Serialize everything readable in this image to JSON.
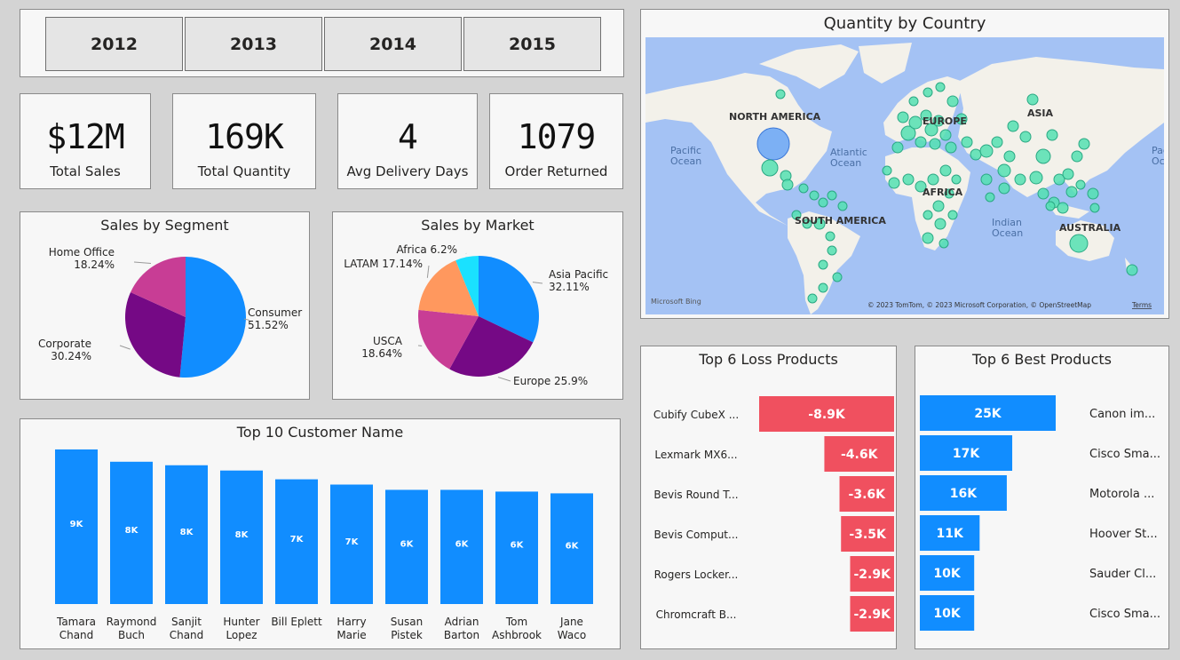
{
  "slicer": {
    "years": [
      "2012",
      "2013",
      "2014",
      "2015"
    ]
  },
  "kpis": [
    {
      "value": "$12M",
      "label": "Total Sales"
    },
    {
      "value": "169K",
      "label": "Total Quantity"
    },
    {
      "value": "4",
      "label": "Avg Delivery Days"
    },
    {
      "value": "1079",
      "label": "Order Returned"
    }
  ],
  "map": {
    "title": "Quantity by Country",
    "labels": {
      "north_america": "NORTH AMERICA",
      "south_america": "SOUTH AMERICA",
      "europe": "EUROPE",
      "africa": "AFRICA",
      "asia": "ASIA",
      "australia": "AUSTRALIA",
      "pacific_left": "Pacific Ocean",
      "pacific_right": "Paci Oce",
      "atlantic": "Atlantic Ocean",
      "indian": "Indian Ocean"
    },
    "bing": "Microsoft Bing",
    "copyright": "© 2023 TomTom, © 2023 Microsoft Corporation, © OpenStreetMap",
    "terms": "Terms"
  },
  "colors": {
    "blue": "#118dff",
    "purple": "#750985",
    "magenta": "#c83d95",
    "orange": "#ff985e",
    "cyan": "#1ae1ff",
    "loss": "#f0505f",
    "ocean": "#a4c2f4",
    "land": "#f3f1ea",
    "bubble": "#54e0b2"
  },
  "chart_data": [
    {
      "type": "pie",
      "title": "Sales by Segment",
      "labels": [
        "Consumer",
        "Corporate",
        "Home Office"
      ],
      "values": [
        51.52,
        30.24,
        18.24
      ],
      "display": [
        "Consumer\n51.52%",
        "Corporate\n30.24%",
        "Home Office\n18.24%"
      ]
    },
    {
      "type": "pie",
      "title": "Sales by Market",
      "labels": [
        "Asia Pacific",
        "Europe",
        "USCA",
        "LATAM",
        "Africa"
      ],
      "values": [
        32.11,
        25.9,
        18.64,
        17.14,
        6.2
      ],
      "display": [
        "Asia Pacific\n32.11%",
        "Europe 25.9%",
        "USCA\n18.64%",
        "LATAM 17.14%",
        "Africa 6.2%"
      ]
    },
    {
      "type": "bar",
      "title": "Top 10 Customer Name",
      "categories": [
        "Tamara Chand",
        "Raymond Buch",
        "Sanjit Chand",
        "Hunter Lopez",
        "Bill Eplett",
        "Harry Marie",
        "Susan Pistek",
        "Adrian Barton",
        "Tom Ashbrook",
        "Jane Waco"
      ],
      "category_lines": [
        [
          "Tamara",
          "Chand"
        ],
        [
          "Raymond",
          "Buch"
        ],
        [
          "Sanjit",
          "Chand"
        ],
        [
          "Hunter",
          "Lopez"
        ],
        [
          "Bill Eplett"
        ],
        [
          "Harry",
          "Marie"
        ],
        [
          "Susan",
          "Pistek"
        ],
        [
          "Adrian",
          "Barton"
        ],
        [
          "Tom",
          "Ashbrook"
        ],
        [
          "Jane",
          "Waco"
        ]
      ],
      "values": [
        8.8,
        8.1,
        7.9,
        7.6,
        7.1,
        6.8,
        6.5,
        6.5,
        6.4,
        6.3
      ],
      "data_labels": [
        "9K",
        "8K",
        "8K",
        "8K",
        "7K",
        "7K",
        "6K",
        "6K",
        "6K",
        "6K"
      ]
    },
    {
      "type": "bar",
      "title": "Top 6 Loss Products",
      "categories": [
        "Cubify CubeX ...",
        "Lexmark MX6...",
        "Bevis Round T...",
        "Bevis Comput...",
        "Rogers Locker...",
        "Chromcraft B..."
      ],
      "values": [
        -8.9,
        -4.6,
        -3.6,
        -3.5,
        -2.9,
        -2.9
      ],
      "data_labels": [
        "-8.9K",
        "-4.6K",
        "-3.6K",
        "-3.5K",
        "-2.9K",
        "-2.9K"
      ]
    },
    {
      "type": "bar",
      "title": "Top 6 Best Products",
      "categories": [
        "Canon im...",
        "Cisco Sma...",
        "Motorola ...",
        "Hoover St...",
        "Sauder Cl...",
        "Cisco Sma..."
      ],
      "values": [
        25,
        17,
        16,
        11,
        10,
        10
      ],
      "data_labels": [
        "25K",
        "17K",
        "16K",
        "11K",
        "10K",
        "10K"
      ]
    }
  ]
}
